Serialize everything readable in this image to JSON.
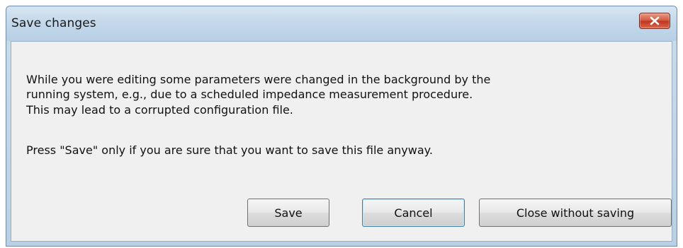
{
  "dialog": {
    "title": "Save changes",
    "close_icon": "close-icon",
    "accent_close": "#c7412a",
    "message_lines": [
      "While you were editing some parameters were changed in the background by the",
      "running system, e.g., due to a scheduled impedance measurement procedure.",
      "This may lead to a corrupted configuration file."
    ],
    "prompt": "Press \"Save\" only if you are sure that you want to save this file anyway.",
    "buttons": {
      "save": "Save",
      "cancel": "Cancel",
      "close_without_saving": "Close without saving"
    }
  }
}
